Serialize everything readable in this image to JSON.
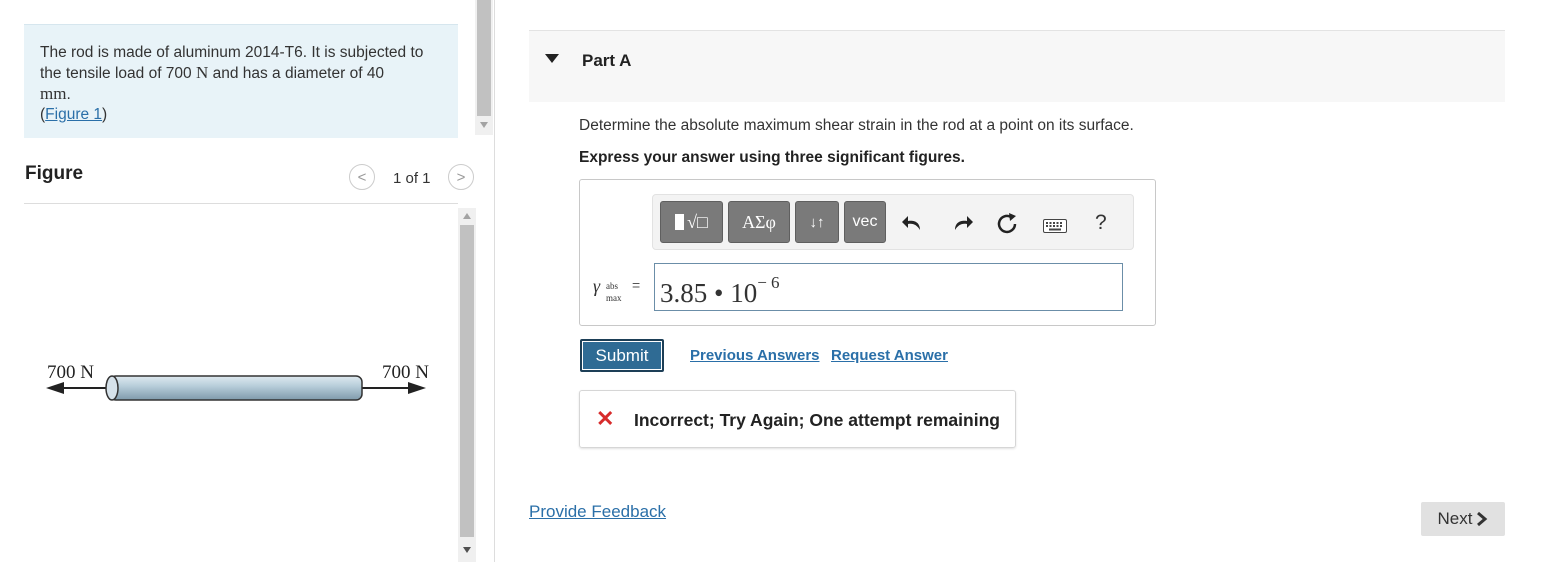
{
  "problem": {
    "text_part1": "The rod is made of aluminum 2014-T6. It is subjected to the tensile load of 700",
    "unit_N": "N",
    "text_part2": "and has a diameter of 40",
    "unit_mm": "mm",
    "period": ".",
    "figure_link": "Figure 1"
  },
  "figure": {
    "title": "Figure",
    "pager": "1 of 1",
    "prev_glyph": "<",
    "next_glyph": ">",
    "left_load": "700 N",
    "right_load": "700 N"
  },
  "part": {
    "title": "Part A",
    "question": "Determine the absolute maximum shear strain in the rod at a point on its surface.",
    "instruction": "Express your answer using three significant figures."
  },
  "toolbar": {
    "templates_label": "√□",
    "greek_label": "ΑΣφ",
    "arrows_label": "↓↑",
    "vec_label": "vec",
    "help_label": "?"
  },
  "answer": {
    "variable": "γ",
    "sub_top": "abs",
    "sub_bottom": "max",
    "equals": "=",
    "mantissa": "3.85 • 10",
    "exponent": "− 6"
  },
  "actions": {
    "submit": "Submit",
    "previous_answers": "Previous Answers",
    "request_answer": "Request Answer"
  },
  "feedback": {
    "icon": "✕",
    "message": "Incorrect; Try Again; One attempt remaining"
  },
  "footer": {
    "provide_feedback": "Provide Feedback",
    "next": "Next"
  },
  "colors": {
    "problem_bg": "#e8f3f8",
    "link": "#2a6fa8",
    "submit_bg": "#2f6b94",
    "error": "#d72b2b"
  }
}
